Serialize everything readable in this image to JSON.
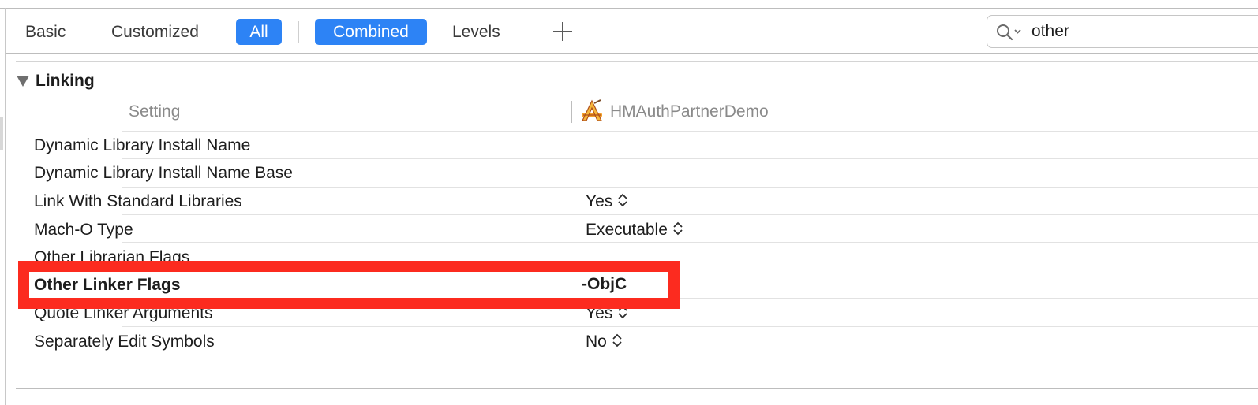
{
  "toolbar": {
    "basic_label": "Basic",
    "customized_label": "Customized",
    "all_label": "All",
    "combined_label": "Combined",
    "levels_label": "Levels",
    "add_icon": "plus-icon"
  },
  "search": {
    "value": "other",
    "icon": "magnifier-dropdown-icon"
  },
  "section": {
    "title": "Linking",
    "toggle_icon": "disclosure-triangle-down-icon"
  },
  "columns": {
    "setting": "Setting",
    "target": "HMAuthPartnerDemo",
    "target_icon": "xcode-app-target-icon"
  },
  "rows": [
    {
      "name": "Dynamic Library Install Name",
      "value": ""
    },
    {
      "name": "Dynamic Library Install Name Base",
      "value": ""
    },
    {
      "name": "Link With Standard Libraries",
      "value": "Yes"
    },
    {
      "name": "Mach-O Type",
      "value": "Executable"
    },
    {
      "name": "Other Librarian Flags",
      "value": ""
    },
    {
      "name": "Other Linker Flags",
      "value": "-ObjC"
    },
    {
      "name": "Quote Linker Arguments",
      "value": "Yes"
    },
    {
      "name": "Separately Edit Symbols",
      "value": "No"
    }
  ],
  "colors": {
    "accent": "#2d83f5",
    "highlight": "#fc2b1f"
  }
}
